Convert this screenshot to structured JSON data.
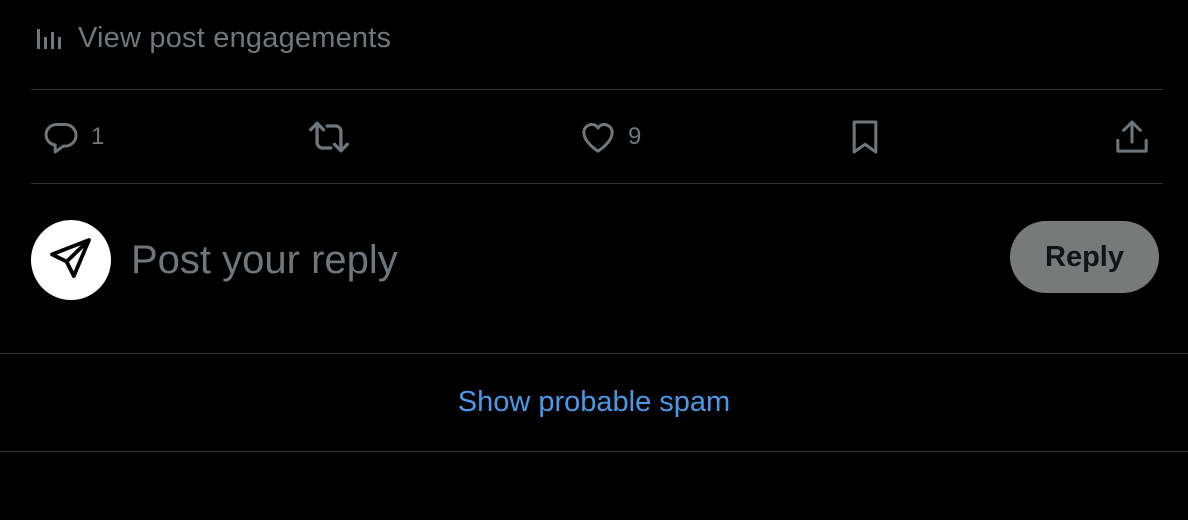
{
  "engagements": {
    "label": "View post engagements",
    "icon": "bar-chart-icon"
  },
  "actions": {
    "reply": {
      "icon": "reply-icon",
      "count": "1"
    },
    "repost": {
      "icon": "repost-icon",
      "count": ""
    },
    "like": {
      "icon": "heart-icon",
      "count": "9"
    },
    "bookmark": {
      "icon": "bookmark-icon"
    },
    "share": {
      "icon": "share-icon"
    }
  },
  "composer": {
    "avatar_icon": "paper-plane-icon",
    "placeholder": "Post your reply",
    "reply_button_label": "Reply"
  },
  "spam": {
    "label": "Show probable spam"
  },
  "colors": {
    "background": "#000000",
    "muted_text": "#71767b",
    "divider": "#2f3336",
    "link": "#4a99e9",
    "reply_button_bg": "#787a7a"
  }
}
